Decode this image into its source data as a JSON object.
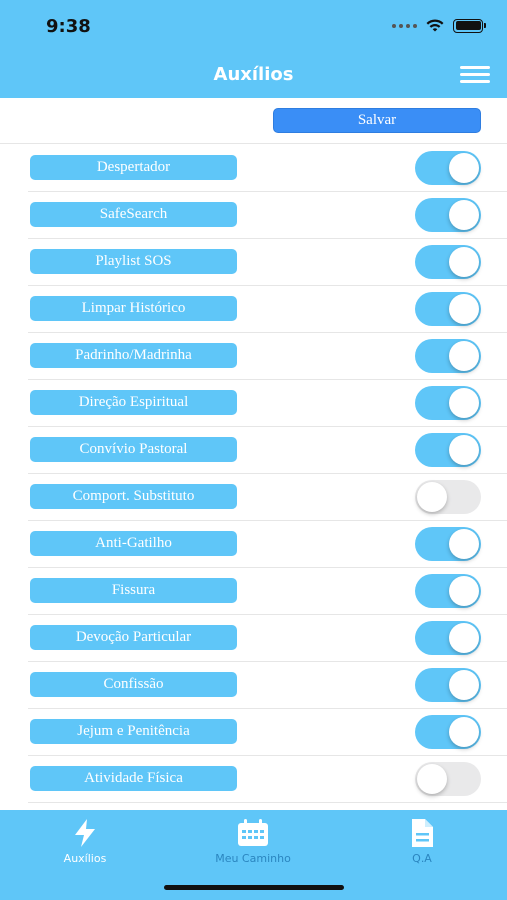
{
  "status_bar": {
    "time": "9:38"
  },
  "header": {
    "title": "Auxílios"
  },
  "save_button": {
    "label": "Salvar"
  },
  "items": [
    {
      "label": "Despertador",
      "enabled": true
    },
    {
      "label": "SafeSearch",
      "enabled": true
    },
    {
      "label": "Playlist SOS",
      "enabled": true
    },
    {
      "label": "Limpar Histórico",
      "enabled": true
    },
    {
      "label": "Padrinho/Madrinha",
      "enabled": true
    },
    {
      "label": "Direção Espiritual",
      "enabled": true
    },
    {
      "label": "Convívio Pastoral",
      "enabled": true
    },
    {
      "label": "Comport. Substituto",
      "enabled": false
    },
    {
      "label": "Anti-Gatilho",
      "enabled": true
    },
    {
      "label": "Fissura",
      "enabled": true
    },
    {
      "label": "Devoção Particular",
      "enabled": true
    },
    {
      "label": "Confissão",
      "enabled": true
    },
    {
      "label": "Jejum e Penitência",
      "enabled": true
    },
    {
      "label": "Atividade Física",
      "enabled": false
    }
  ],
  "tabs": [
    {
      "label": "Auxílios",
      "icon": "bolt-icon",
      "active": true
    },
    {
      "label": "Meu Caminho",
      "icon": "calendar-icon",
      "active": false
    },
    {
      "label": "Q.A",
      "icon": "document-icon",
      "active": false
    }
  ],
  "colors": {
    "accent": "#5fc6f8",
    "save_button": "#3a8ef6",
    "toggle_off": "#e9e9ea",
    "tab_inactive_text": "#2b86c0"
  }
}
